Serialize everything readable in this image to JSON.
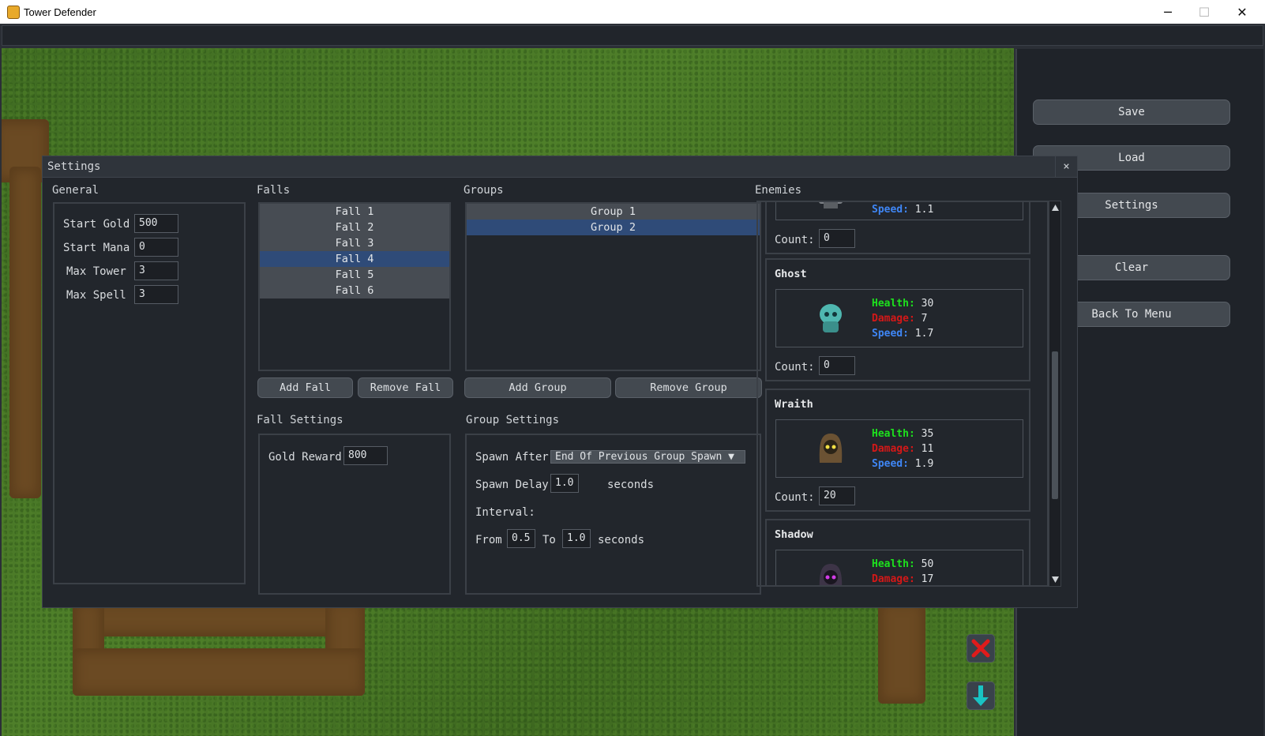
{
  "window": {
    "title": "Tower Defender",
    "minimize": "─",
    "maximize": "☐",
    "close": "✕"
  },
  "sidebar": {
    "buttons": [
      "Save",
      "Load",
      "Settings",
      "Clear",
      "Back To Menu"
    ]
  },
  "dialog": {
    "title": "Settings",
    "close": "×",
    "general": {
      "label": "General",
      "fields": [
        {
          "label": "Start Gold",
          "value": "500"
        },
        {
          "label": "Start Mana",
          "value": "0"
        },
        {
          "label": "Max Tower",
          "value": "3"
        },
        {
          "label": "Max Spell",
          "value": "3"
        }
      ]
    },
    "falls": {
      "label": "Falls",
      "items": [
        "Fall 1",
        "Fall 2",
        "Fall 3",
        "Fall 4",
        "Fall 5",
        "Fall 6"
      ],
      "selected": "Fall 4",
      "add": "Add Fall",
      "remove": "Remove Fall"
    },
    "groups": {
      "label": "Groups",
      "items": [
        "Group 1",
        "Group 2"
      ],
      "selected": "Group 2",
      "add": "Add Group",
      "remove": "Remove Group"
    },
    "fall_settings": {
      "label": "Fall Settings",
      "gold_reward_label": "Gold Reward",
      "gold_reward": "800"
    },
    "group_settings": {
      "label": "Group Settings",
      "spawn_after_label": "Spawn After",
      "spawn_after": "End Of Previous Group Spawn ▼",
      "spawn_delay_label": "Spawn Delay",
      "spawn_delay": "1.0",
      "seconds": "seconds",
      "interval_label": "Interval:",
      "from_label": "From",
      "from": "0.5",
      "to_label": "To",
      "to": "1.0"
    },
    "enemies": {
      "label": "Enemies",
      "count_label": "Count:",
      "health_label": "Health:",
      "damage_label": "Damage:",
      "speed_label": "Speed:",
      "partial_top": {
        "speed": "1.1",
        "count": "0"
      },
      "list": [
        {
          "name": "Ghost",
          "health": "30",
          "damage": "7",
          "speed": "1.7",
          "count": "0",
          "color": "#4fb7b0"
        },
        {
          "name": "Wraith",
          "health": "35",
          "damage": "11",
          "speed": "1.9",
          "count": "20",
          "color": "#6b5233"
        },
        {
          "name": "Shadow",
          "health": "50",
          "damage": "17",
          "speed": "",
          "count": "",
          "color": "#3d3447"
        }
      ]
    }
  }
}
